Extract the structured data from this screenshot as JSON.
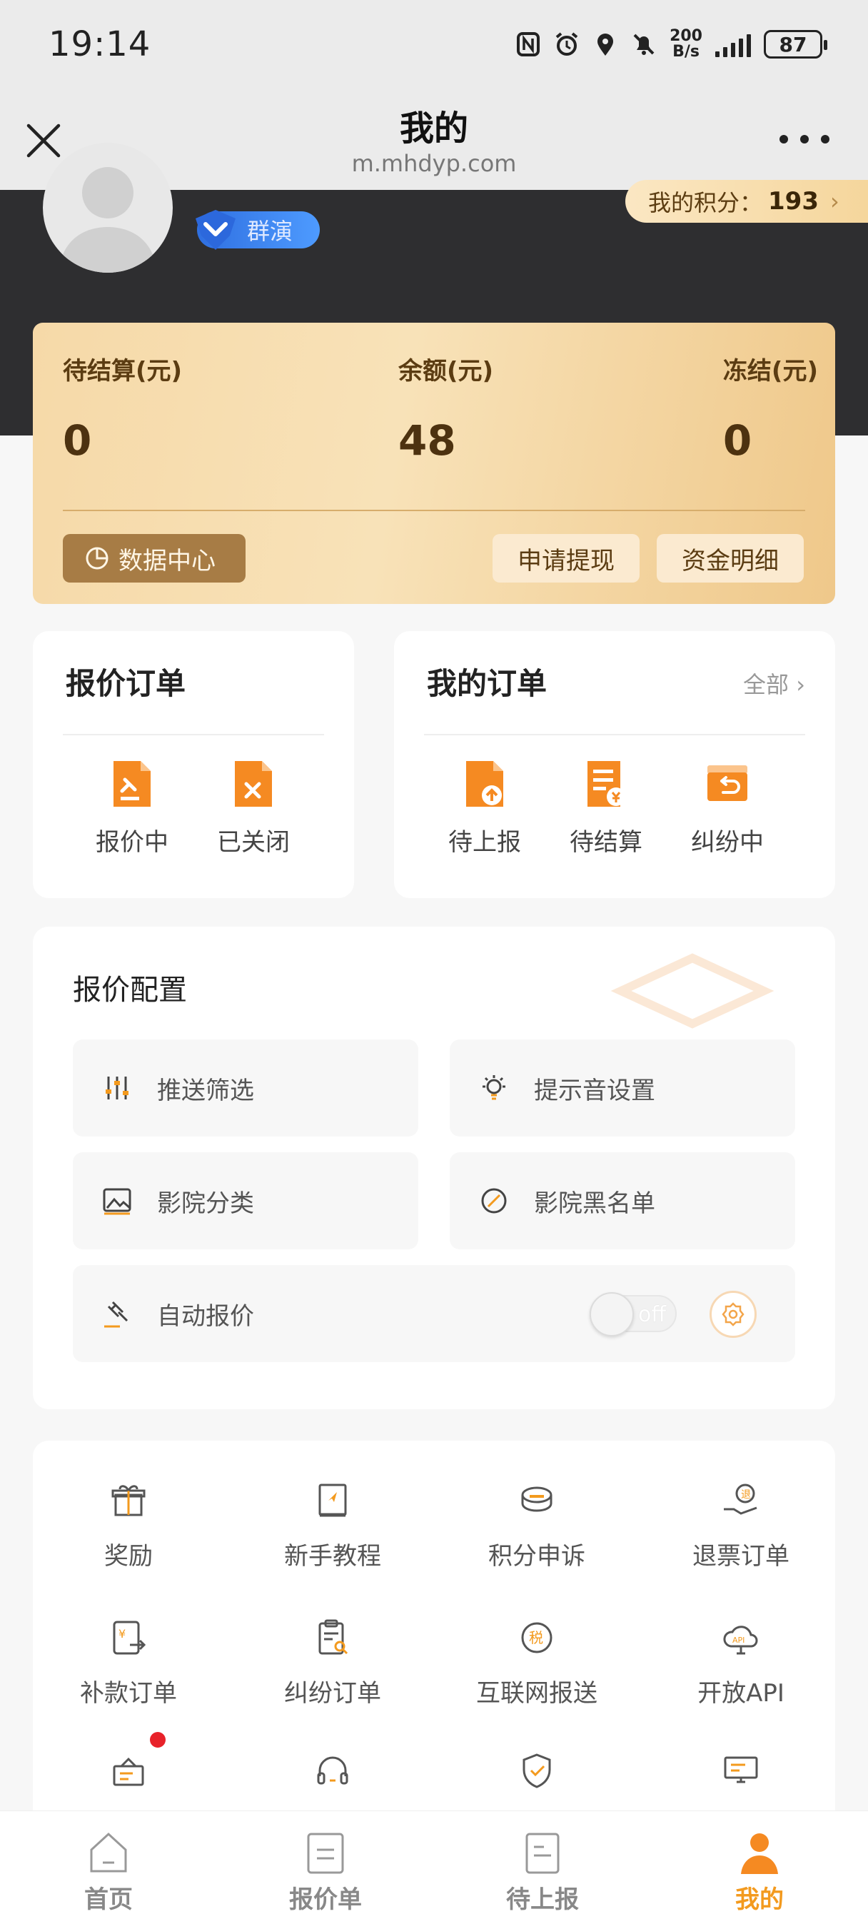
{
  "status_bar": {
    "time": "19:14",
    "net_speed_value": "200",
    "net_speed_unit": "B/s",
    "battery": "87"
  },
  "title_bar": {
    "title": "我的",
    "url": "m.mhdyp.com"
  },
  "profile": {
    "badge_label": "群演",
    "points_label": "我的积分：",
    "points_value": "193"
  },
  "balance": {
    "pending_label": "待结算(元)",
    "pending_value": "0",
    "balance_label": "余额(元)",
    "balance_value": "48",
    "frozen_label": "冻结(元)",
    "frozen_value": "0",
    "data_center": "数据中心",
    "withdraw": "申请提现",
    "details": "资金明细"
  },
  "quote_orders": {
    "title": "报价订单",
    "items": [
      {
        "label": "报价中"
      },
      {
        "label": "已关闭"
      }
    ]
  },
  "my_orders": {
    "title": "我的订单",
    "see_all": "全部",
    "items": [
      {
        "label": "待上报"
      },
      {
        "label": "待结算"
      },
      {
        "label": "纠纷中"
      }
    ]
  },
  "quote_config": {
    "title": "报价配置",
    "items": [
      {
        "label": "推送筛选"
      },
      {
        "label": "提示音设置"
      },
      {
        "label": "影院分类"
      },
      {
        "label": "影院黑名单"
      }
    ],
    "auto_quote": {
      "label": "自动报价",
      "toggle_text": "off"
    }
  },
  "tools": {
    "items": [
      {
        "label": "奖励"
      },
      {
        "label": "新手教程"
      },
      {
        "label": "积分申诉"
      },
      {
        "label": "退票订单"
      },
      {
        "label": "补款订单"
      },
      {
        "label": "纠纷订单"
      },
      {
        "label": "互联网报送"
      },
      {
        "label": "开放API"
      }
    ]
  },
  "bottom_nav": {
    "items": [
      {
        "label": "首页"
      },
      {
        "label": "报价单"
      },
      {
        "label": "待上报"
      },
      {
        "label": "我的"
      }
    ]
  },
  "colors": {
    "accent": "#f39a1e",
    "dark_header": "#2e2e30",
    "card_gold": "#f6d9a8"
  }
}
